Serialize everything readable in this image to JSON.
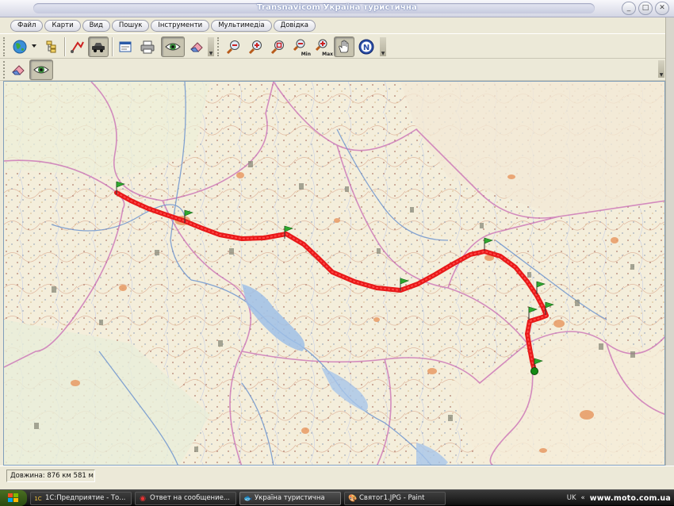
{
  "window": {
    "title": "Transnavicom Україна туристична",
    "buttons": [
      "_",
      "□",
      "✕"
    ]
  },
  "menu": {
    "items": [
      "Файл",
      "Карти",
      "Вид",
      "Пошук",
      "Інструменти",
      "Мультимедіа",
      "Довідка"
    ]
  },
  "toolbar": {
    "row1": [
      {
        "name": "globe-icon",
        "glyph": "🌐"
      },
      {
        "name": "layers-icon",
        "glyph": "▤"
      },
      {
        "name": "route-tool-icon",
        "glyph": "✎"
      },
      {
        "name": "vehicle-icon",
        "glyph": "🚗"
      },
      {
        "name": "window-icon",
        "glyph": "▣"
      },
      {
        "name": "printer-icon",
        "glyph": "🖨"
      },
      {
        "name": "eye-icon",
        "glyph": "👁"
      },
      {
        "name": "eraser-icon",
        "glyph": "▱"
      },
      {
        "name": "zoom-out-icon",
        "glyph": "🔍"
      },
      {
        "name": "zoom-in-icon",
        "glyph": "🔍"
      },
      {
        "name": "zoom-rect-icon",
        "glyph": "🔍"
      },
      {
        "name": "zoom-min-icon",
        "glyph": "🔍"
      },
      {
        "name": "zoom-max-icon",
        "glyph": "🔍"
      },
      {
        "name": "hand-pan-icon",
        "glyph": "✋"
      },
      {
        "name": "north-compass-icon",
        "glyph": "N"
      }
    ],
    "row2": [
      {
        "name": "eraser-icon",
        "glyph": "▱"
      },
      {
        "name": "eye-icon",
        "glyph": "👁"
      }
    ],
    "zoom_labels": {
      "min": "Min",
      "max": "Max"
    }
  },
  "map": {
    "route_color": "#e81818",
    "flag_color": "#2fa82f",
    "end_marker_color": "#148a14"
  },
  "status": {
    "length": "Довжина: 876 км 581 м"
  },
  "taskbar": {
    "tasks": [
      {
        "label": "1С:Предприятие - То...",
        "icon": "1C"
      },
      {
        "label": "Ответ на сообщение...",
        "icon": "◉"
      },
      {
        "label": "Україна туристична",
        "icon": "🐟",
        "active": true
      },
      {
        "label": "Святог1.JPG - Paint",
        "icon": "🎨"
      }
    ],
    "lang": "UK",
    "watermark": "www.moto.com.ua"
  }
}
